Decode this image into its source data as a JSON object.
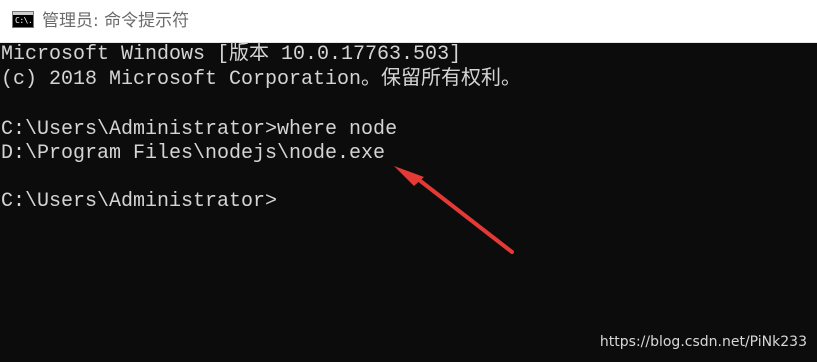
{
  "window": {
    "icon_text": "C:\\.",
    "title": "管理员: 命令提示符"
  },
  "console": {
    "lines": [
      "Microsoft Windows [版本 10.0.17763.503]",
      "(c) 2018 Microsoft Corporation。保留所有权利。",
      "C:\\Users\\Administrator>where node",
      "D:\\Program Files\\nodejs\\node.exe",
      "C:\\Users\\Administrator>"
    ]
  },
  "annotation": {
    "arrow_color": "#e53935"
  },
  "watermark": "https://blog.csdn.net/PiNk233"
}
